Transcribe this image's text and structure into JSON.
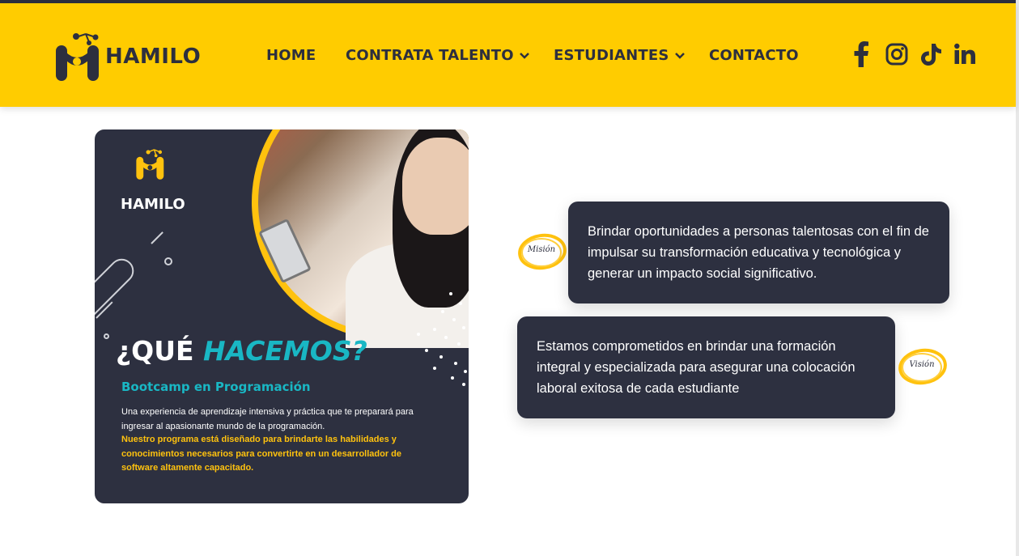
{
  "brand": {
    "name": "HAMILO",
    "logo_icon": "hamilo-molecule-logo"
  },
  "nav": {
    "items": [
      {
        "label": "HOME",
        "has_dropdown": false
      },
      {
        "label": "CONTRATA TALENTO",
        "has_dropdown": true
      },
      {
        "label": "ESTUDIANTES",
        "has_dropdown": true
      },
      {
        "label": "CONTACTO",
        "has_dropdown": false
      }
    ]
  },
  "social": [
    "facebook-icon",
    "instagram-icon",
    "tiktok-icon",
    "linkedin-icon"
  ],
  "promo": {
    "brand": "HAMILO",
    "heading_prefix": "¿QUÉ ",
    "heading_highlight": "HACEMOS?",
    "subheading": "Bootcamp en Programación",
    "body": "Una experiencia de aprendizaje intensiva y práctica que te preparará para ingresar al apasionante mundo de la programación.",
    "body_highlight": "Nuestro programa está diseñado para brindarte las habilidades y conocimientos necesarios para convertirte en un desarrollador de software altamente capacitado."
  },
  "mission": {
    "badge": "Misión",
    "text": "Brindar oportunidades a personas talentosas con el fin de impulsar su transformación educativa y tecnológica y generar un impacto social significativo."
  },
  "vision": {
    "badge": "Visión",
    "text": "Estamos comprometidos en brindar una formación integral y especializada para asegurar una colocación laboral exitosa de cada estudiante"
  },
  "colors": {
    "accent": "#ffcc00",
    "dark": "#2d3040",
    "teal": "#19b7c4"
  }
}
